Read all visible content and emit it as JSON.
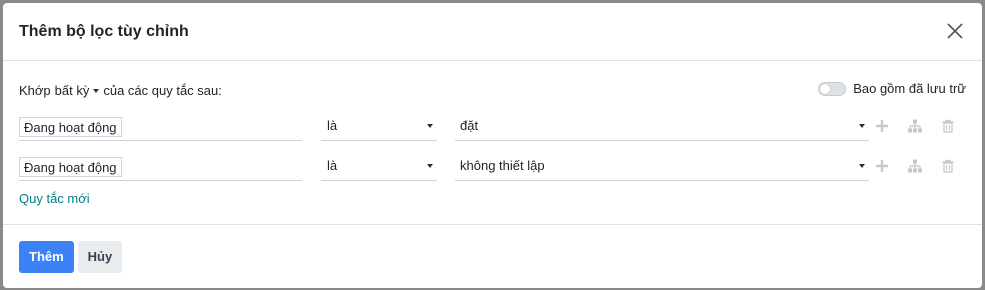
{
  "dialog": {
    "title": "Thêm bộ lọc tùy chỉnh"
  },
  "match": {
    "prefix": "Khớp",
    "selected": "bất kỳ",
    "suffix": "của các quy tắc sau:"
  },
  "archive_toggle": {
    "label": "Bao gồm đã lưu trữ",
    "checked": false
  },
  "rules": [
    {
      "field": "Đang hoạt động",
      "operator": "là",
      "value": "đặt"
    },
    {
      "field": "Đang hoạt động",
      "operator": "là",
      "value": "không thiết lập"
    }
  ],
  "new_rule_label": "Quy tắc mới",
  "footer": {
    "add_label": "Thêm",
    "cancel_label": "Hủy"
  },
  "colors": {
    "primary": "#3b82f6",
    "link": "#017e84"
  },
  "icons": [
    "close-icon",
    "plus-icon",
    "hierarchy-icon",
    "trash-icon",
    "caret-down-icon"
  ]
}
